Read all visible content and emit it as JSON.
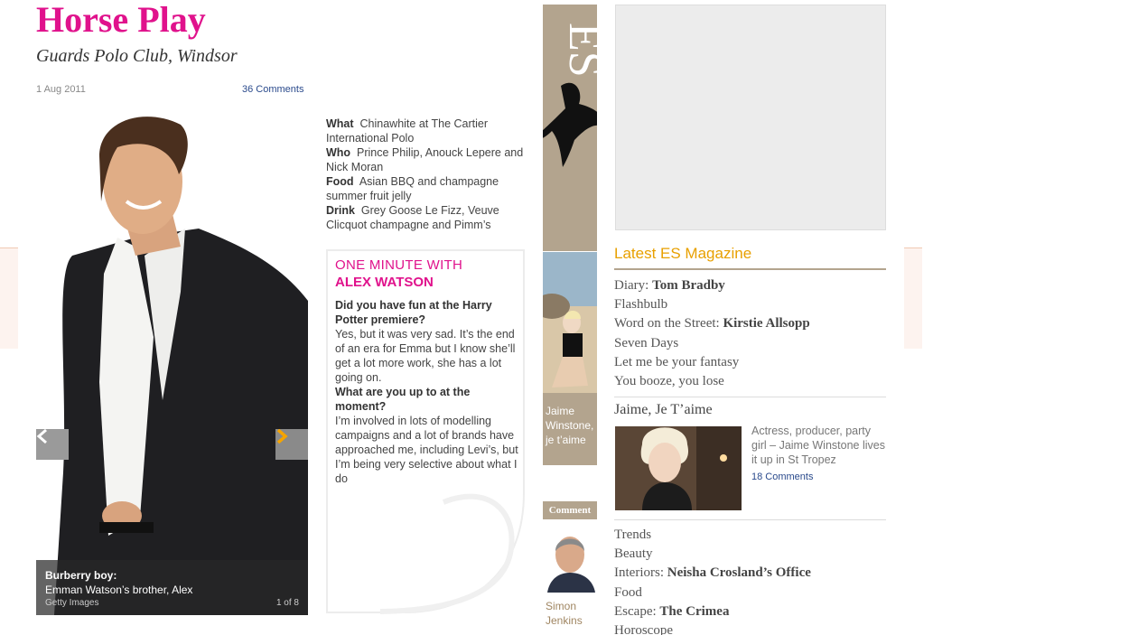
{
  "article": {
    "title": "Horse Play",
    "subtitle": "Guards Polo Club, Windsor",
    "date": "1 Aug 2011",
    "comments": "36 Comments"
  },
  "gallery": {
    "caption_title": "Burberry boy:",
    "caption_text": "Emman Watson’s brother, Alex",
    "credit": "Getty Images",
    "counter": "1 of 8"
  },
  "facts": [
    {
      "label": "What",
      "text": "Chinawhite at The Cartier International Polo"
    },
    {
      "label": "Who",
      "text": "Prince Philip, Anouck Lepere and Nick Moran"
    },
    {
      "label": "Food",
      "text": "Asian BBQ and champagne summer fruit jelly"
    },
    {
      "label": "Drink",
      "text": "Grey Goose Le Fizz, Veuve Clicquot champagne and Pimm’s"
    }
  ],
  "minute": {
    "heading_pre": "One minute with",
    "heading_name": "ALEX WATSON",
    "q1": "Did you have fun at the Harry Potter premiere?",
    "a1": "Yes, but it was very sad. It’s the end of an era for Emma but I know she’ll get a lot more work, she has a lot going on.",
    "q2": "What are you up to at the moment?",
    "a2": "I’m involved in lots of modelling campaigns and a lot of brands have approached me, including Levi’s, but I’m being very selective about what I do"
  },
  "sidebar": {
    "es_logo": "ES",
    "promo_caption": "Jaime Winstone, je t’aime",
    "comment_label": "Comment",
    "comment_author": "Simon Jenkins"
  },
  "latest": {
    "heading": "Latest ES Magazine",
    "items": [
      {
        "prefix": "Diary: ",
        "bold": "Tom Bradby"
      },
      {
        "prefix": "Flashbulb",
        "bold": ""
      },
      {
        "prefix": "Word on the Street: ",
        "bold": "Kirstie Allsopp"
      },
      {
        "prefix": "Seven Days",
        "bold": ""
      },
      {
        "prefix": "Let me be your fantasy",
        "bold": ""
      },
      {
        "prefix": "You booze, you lose",
        "bold": ""
      }
    ],
    "feature": {
      "title": "Jaime, Je T’aime",
      "text": "Actress, producer, party girl – Jaime Winstone lives it up in St Tropez",
      "comments": "18 Comments"
    },
    "items2": [
      {
        "prefix": "Trends",
        "bold": ""
      },
      {
        "prefix": "Beauty",
        "bold": ""
      },
      {
        "prefix": "Interiors: ",
        "bold": "Neisha Crosland’s Office"
      },
      {
        "prefix": "Food",
        "bold": ""
      },
      {
        "prefix": "Escape: ",
        "bold": "The Crimea"
      },
      {
        "prefix": "Horoscope",
        "bold": ""
      }
    ]
  },
  "colors": {
    "title_pink": "#e0128c",
    "tan": "#b3a48e",
    "latest_orange": "#e8a000",
    "link_blue": "#2a4a8c"
  }
}
